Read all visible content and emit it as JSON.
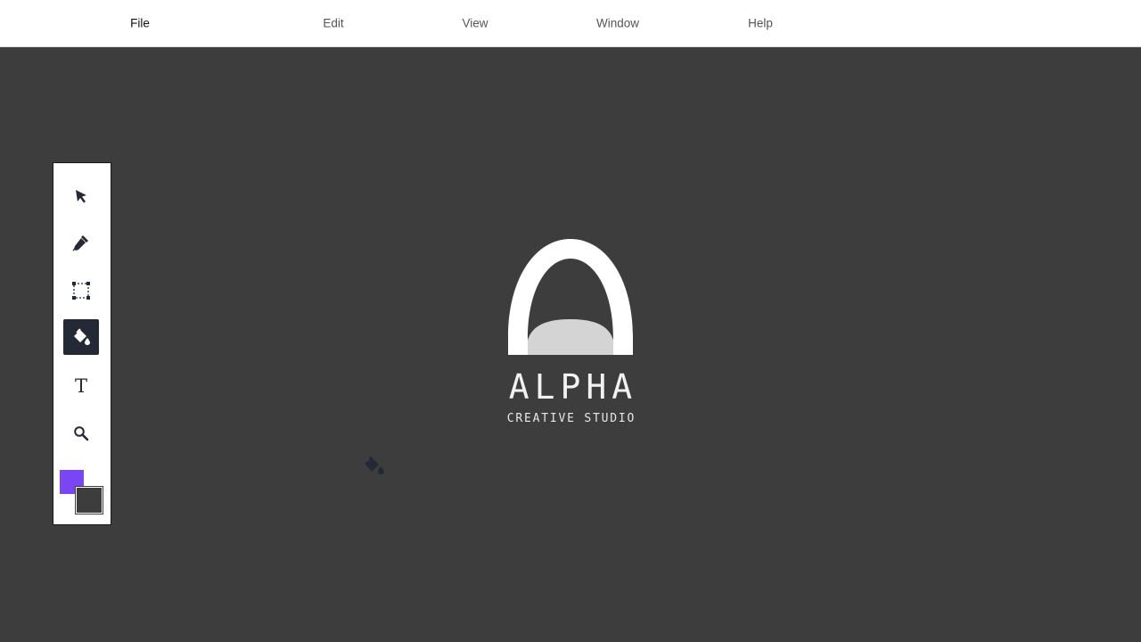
{
  "menubar": {
    "items": [
      {
        "label": "File",
        "active": true
      },
      {
        "label": "Edit",
        "active": false
      },
      {
        "label": "View",
        "active": false
      },
      {
        "label": "Window",
        "active": false
      },
      {
        "label": "Help",
        "active": false
      }
    ]
  },
  "toolbox": {
    "tools": [
      {
        "name": "select",
        "icon": "arrow-pointer-icon",
        "selected": false
      },
      {
        "name": "pen",
        "icon": "pen-icon",
        "selected": false
      },
      {
        "name": "transform",
        "icon": "bounding-box-icon",
        "selected": false
      },
      {
        "name": "paint-bucket",
        "icon": "paint-bucket-icon",
        "selected": true
      },
      {
        "name": "text",
        "icon": "text-icon",
        "glyph": "T",
        "selected": false
      },
      {
        "name": "zoom",
        "icon": "magnifier-icon",
        "selected": false
      }
    ],
    "primary_color": "#7a45f5",
    "secondary_color": "#3d3d3d"
  },
  "canvas": {
    "background_color": "#3d3d3d",
    "logo": {
      "title": "ALPHA",
      "subtitle": "CREATIVE STUDIO",
      "arch_color": "#ffffff",
      "band_color": "#d4d4d4"
    },
    "cursor_icon": "paint-bucket-icon",
    "cursor_color": "#232a36"
  }
}
